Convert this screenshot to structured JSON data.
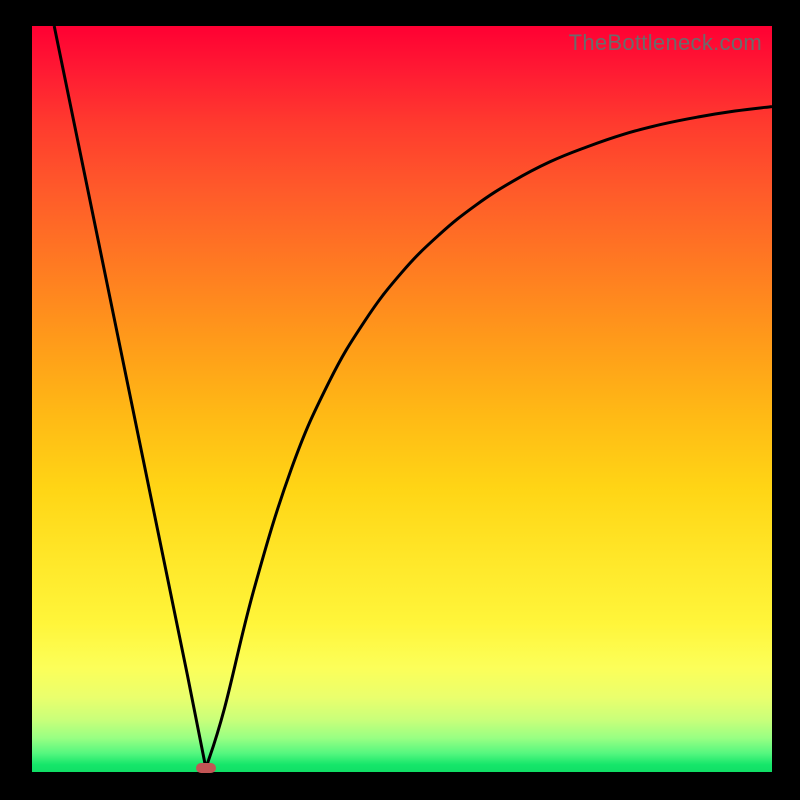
{
  "watermark": {
    "text": "TheBottleneck.com"
  },
  "colors": {
    "frame": "#000000",
    "curve_stroke": "#000000",
    "marker_fill": "#c25555",
    "gradient_top": "#ff0033",
    "gradient_bottom": "#10df66"
  },
  "chart_data": {
    "type": "line",
    "title": "",
    "xlabel": "",
    "ylabel": "",
    "xlim": [
      0,
      1
    ],
    "ylim": [
      0,
      1
    ],
    "grid": false,
    "legend": false,
    "annotations": [
      {
        "name": "vertex-marker",
        "x": 0.235,
        "y": 0.005,
        "shape": "rounded-rect",
        "color": "#c25555"
      }
    ],
    "series": [
      {
        "name": "bottleneck-curve",
        "x": [
          0.03,
          0.06,
          0.09,
          0.12,
          0.15,
          0.18,
          0.21,
          0.235,
          0.26,
          0.3,
          0.35,
          0.4,
          0.45,
          0.5,
          0.55,
          0.6,
          0.65,
          0.7,
          0.75,
          0.8,
          0.85,
          0.9,
          0.95,
          1.0
        ],
        "y": [
          1.0,
          0.855,
          0.71,
          0.565,
          0.42,
          0.275,
          0.13,
          0.005,
          0.085,
          0.245,
          0.405,
          0.52,
          0.605,
          0.67,
          0.72,
          0.76,
          0.792,
          0.818,
          0.838,
          0.855,
          0.868,
          0.878,
          0.886,
          0.892
        ]
      }
    ]
  }
}
